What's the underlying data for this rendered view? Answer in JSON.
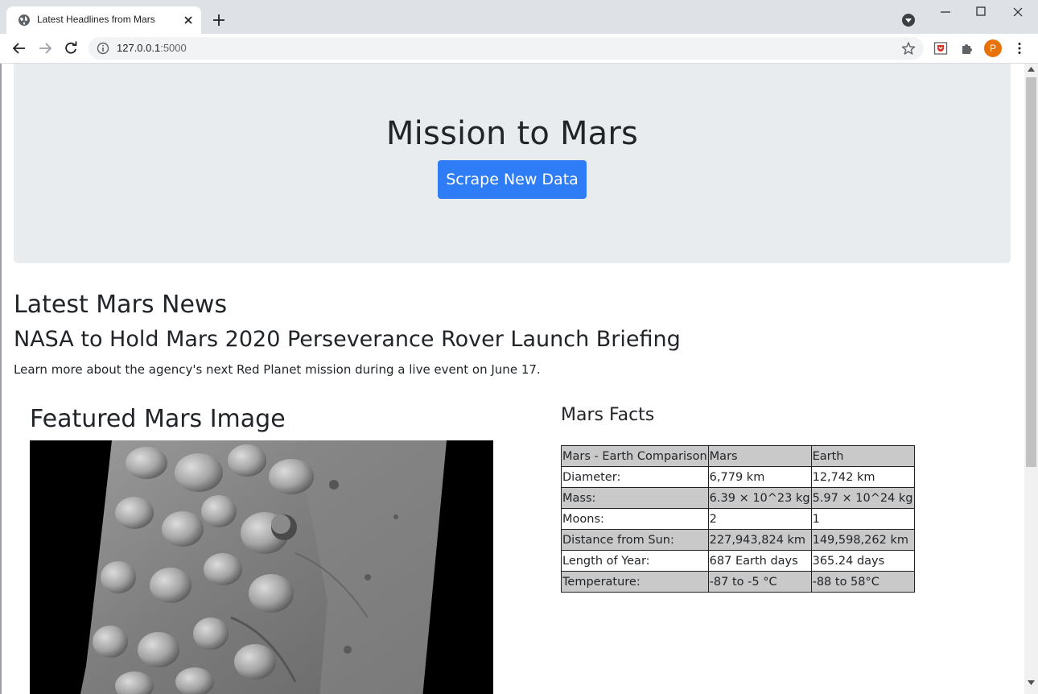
{
  "browser": {
    "tab_title": "Latest Headlines from Mars",
    "url_host": "127.0.0.1",
    "url_port": ":5000",
    "profile_initial": "P",
    "icons": [
      "globe-icon",
      "close-icon",
      "plus-icon",
      "chevron-down-icon",
      "minimize-icon",
      "maximize-icon",
      "back-arrow-icon",
      "forward-arrow-icon",
      "reload-icon",
      "info-icon",
      "star-icon",
      "pocket-extension-icon",
      "puzzle-icon",
      "kebab-menu-icon"
    ],
    "accent_colors": {
      "avatar": "#e8710a"
    }
  },
  "jumbotron": {
    "title": "Mission to Mars",
    "button_label": "Scrape New Data",
    "button_color": "#2e7cf6"
  },
  "news": {
    "heading": "Latest Mars News",
    "title": "NASA to Hold Mars 2020 Perseverance Rover Launch Briefing",
    "teaser": "Learn more about the agency's next Red Planet mission during a live event on June 17."
  },
  "featured": {
    "heading": "Featured Mars Image"
  },
  "facts": {
    "heading": "Mars Facts",
    "header": [
      "Mars - Earth Comparison",
      "Mars",
      "Earth"
    ],
    "rows": [
      [
        "Diameter:",
        "6,779 km",
        "12,742 km"
      ],
      [
        "Mass:",
        "6.39 × 10^23 kg",
        "5.97 × 10^24 kg"
      ],
      [
        "Moons:",
        "2",
        "1"
      ],
      [
        "Distance from Sun:",
        "227,943,824 km",
        "149,598,262 km"
      ],
      [
        "Length of Year:",
        "687 Earth days",
        "365.24 days"
      ],
      [
        "Temperature:",
        "-87 to -5 °C",
        "-88 to 58°C"
      ]
    ]
  }
}
